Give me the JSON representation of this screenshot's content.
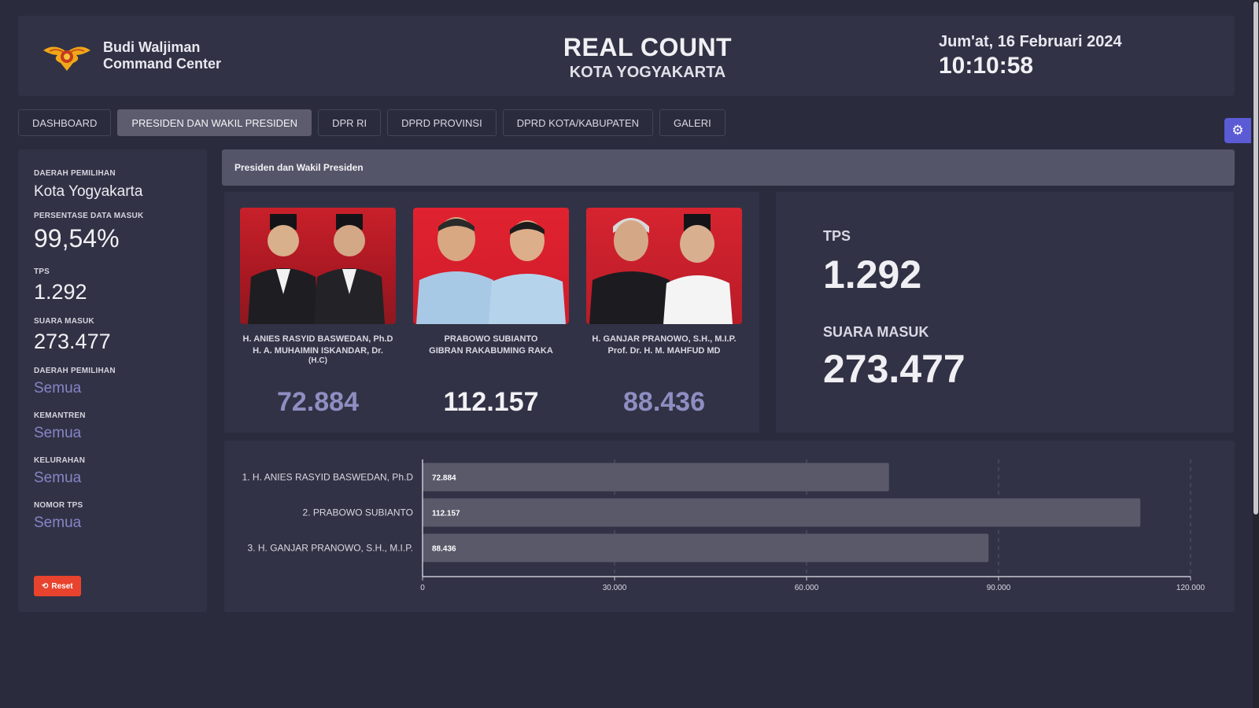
{
  "header": {
    "brand_line1": "Budi Waljiman",
    "brand_line2": "Command Center",
    "title": "REAL COUNT",
    "subtitle": "KOTA YOGYAKARTA",
    "date": "Jum'at, 16 Februari 2024",
    "time": "10:10:58"
  },
  "tabs": [
    {
      "label": "DASHBOARD"
    },
    {
      "label": "PRESIDEN DAN WAKIL PRESIDEN",
      "active": true
    },
    {
      "label": "DPR RI"
    },
    {
      "label": "DPRD PROVINSI"
    },
    {
      "label": "DPRD KOTA/KABUPATEN"
    },
    {
      "label": "GALERI"
    }
  ],
  "sidebar": {
    "dapil_label": "DAERAH PEMILIHAN",
    "dapil_value": "Kota Yogyakarta",
    "persen_label": "PERSENTASE DATA MASUK",
    "persen_value": "99,54%",
    "tps_label": "TPS",
    "tps_value": "1.292",
    "suara_label": "SUARA MASUK",
    "suara_value": "273.477",
    "filters": [
      {
        "label": "DAERAH PEMILIHAN",
        "value": "Semua"
      },
      {
        "label": "KEMANTREN",
        "value": "Semua"
      },
      {
        "label": "KELURAHAN",
        "value": "Semua"
      },
      {
        "label": "NOMOR TPS",
        "value": "Semua"
      }
    ],
    "reset_label": "Reset"
  },
  "panel_title": "Presiden dan Wakil Presiden",
  "candidates": [
    {
      "line1": "H. ANIES RASYID BASWEDAN, Ph.D",
      "line2": "H. A. MUHAIMIN ISKANDAR, Dr.",
      "line3": "(H.C)",
      "votes": "72.884",
      "color": "#8e8ec2"
    },
    {
      "line1": "PRABOWO SUBIANTO",
      "line2": "GIBRAN RAKABUMING RAKA",
      "line3": "",
      "votes": "112.157",
      "color": "#f2f2f6"
    },
    {
      "line1": "H. GANJAR PRANOWO, S.H., M.I.P.",
      "line2": "Prof. Dr. H. M. MAHFUD MD",
      "line3": "",
      "votes": "88.436",
      "color": "#8e8ec2"
    }
  ],
  "summary": {
    "tps_label": "TPS",
    "tps_value": "1.292",
    "suara_label": "SUARA MASUK",
    "suara_value": "273.477"
  },
  "chart_data": {
    "type": "bar",
    "orientation": "horizontal",
    "categories": [
      "1. H. ANIES RASYID BASWEDAN, Ph.D",
      "2. PRABOWO SUBIANTO",
      "3. H. GANJAR PRANOWO, S.H., M.I.P."
    ],
    "values": [
      72884,
      112157,
      88436
    ],
    "value_labels": [
      "72.884",
      "112.157",
      "88.436"
    ],
    "xlim": [
      0,
      120000
    ],
    "ticks": [
      0,
      30000,
      60000,
      90000,
      120000
    ],
    "tick_labels": [
      "0",
      "30.000",
      "60.000",
      "90.000",
      "120.000"
    ],
    "grid": true
  }
}
